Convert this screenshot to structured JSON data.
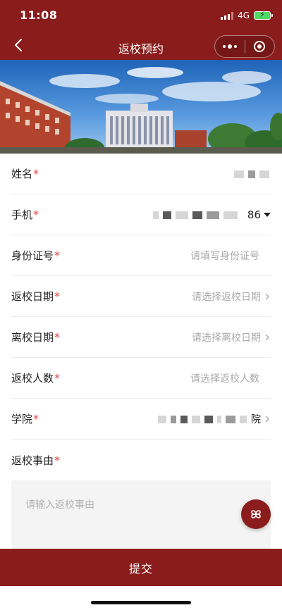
{
  "status_bar": {
    "time": "11:08",
    "network": "4G"
  },
  "nav": {
    "title": "返校预约"
  },
  "form": {
    "name": {
      "label": "姓名",
      "required_mark": "*"
    },
    "phone": {
      "label": "手机",
      "required_mark": "*",
      "country_code": "86"
    },
    "id_card": {
      "label": "身份证号",
      "required_mark": "*",
      "placeholder": "请填写身份证号"
    },
    "return_date": {
      "label": "返校日期",
      "required_mark": "*",
      "placeholder": "请选择返校日期"
    },
    "leave_date": {
      "label": "离校日期",
      "required_mark": "*",
      "placeholder": "请选择离校日期"
    },
    "return_count": {
      "label": "返校人数",
      "required_mark": "*",
      "placeholder": "请选择返校人数"
    },
    "college": {
      "label": "学院",
      "required_mark": "*",
      "value_tail": "院"
    },
    "reason": {
      "label": "返校事由",
      "required_mark": "*",
      "placeholder": "请输入返校事由"
    }
  },
  "submit": {
    "label": "提交"
  },
  "colors": {
    "brand": "#8b1c1c",
    "required": "#e04646",
    "placeholder": "#a9a9a9"
  },
  "icons": [
    "back-arrow-icon",
    "more-dots-icon",
    "target-icon",
    "chevron-right-icon",
    "dropdown-caret-icon",
    "clover-menu-icon"
  ]
}
